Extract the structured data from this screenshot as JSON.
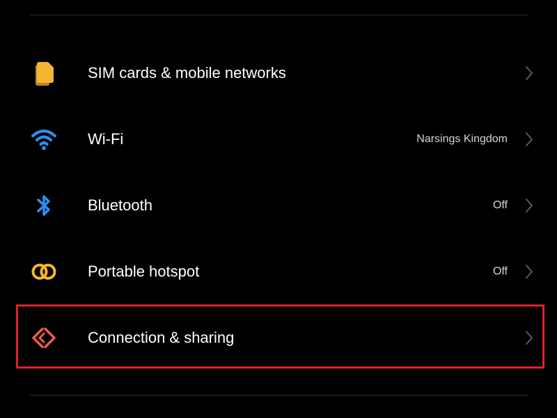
{
  "settings": {
    "items": [
      {
        "id": "sim",
        "label": "SIM cards & mobile networks",
        "value": "",
        "icon": "sim-card-icon",
        "icon_color": "#f5b52e"
      },
      {
        "id": "wifi",
        "label": "Wi-Fi",
        "value": "Narsings Kingdom",
        "icon": "wifi-icon",
        "icon_color": "#2f8ff0"
      },
      {
        "id": "bluetooth",
        "label": "Bluetooth",
        "value": "Off",
        "icon": "bluetooth-icon",
        "icon_color": "#2f8ff0"
      },
      {
        "id": "hotspot",
        "label": "Portable hotspot",
        "value": "Off",
        "icon": "hotspot-icon",
        "icon_color": "#f5b52e"
      },
      {
        "id": "connection",
        "label": "Connection & sharing",
        "value": "",
        "icon": "connection-sharing-icon",
        "icon_color": "#ee5a4d"
      }
    ]
  },
  "highlight": {
    "target": "connection",
    "color": "#e0212b"
  },
  "colors": {
    "background": "#000000",
    "text_primary": "#ffffff",
    "text_secondary": "#d6d6d6",
    "chevron": "#5a5a5a",
    "divider": "#2a2a2a"
  }
}
